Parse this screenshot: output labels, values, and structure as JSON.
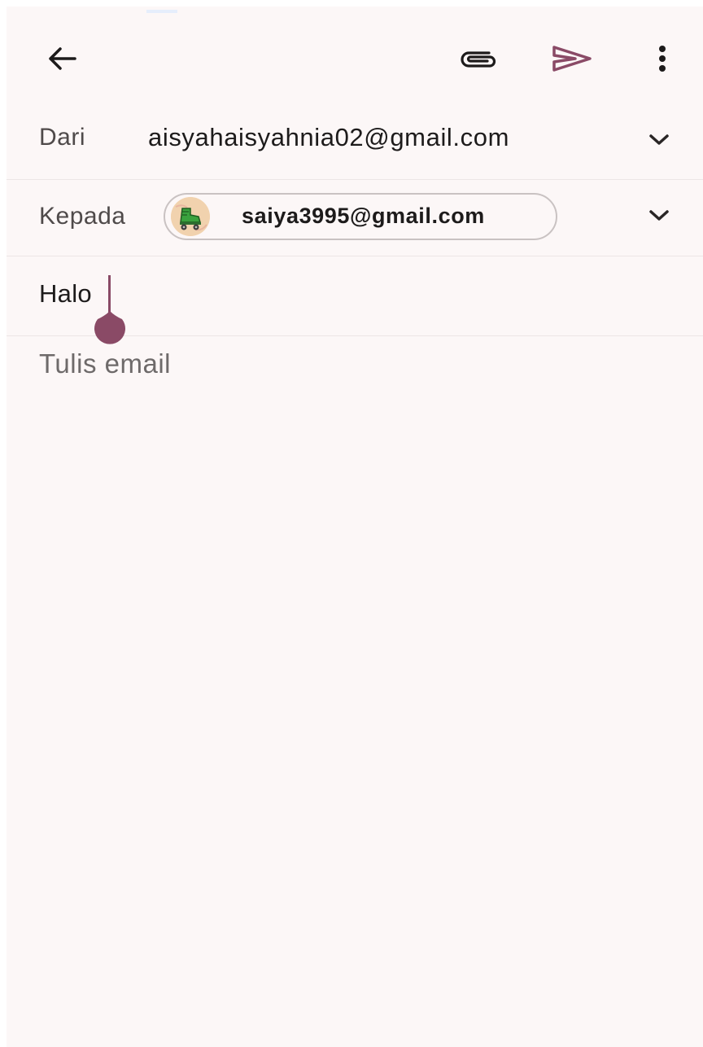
{
  "toolbar": {
    "back_icon": "arrow-left-icon",
    "attach_icon": "paperclip-icon",
    "send_icon": "send-icon",
    "more_icon": "more-vertical-icon"
  },
  "from": {
    "label": "Dari",
    "value": "aisyahaisyahnia02@gmail.com",
    "chevron_icon": "chevron-down-icon"
  },
  "to": {
    "label": "Kepada",
    "recipient": "saiya3995@gmail.com",
    "avatar_icon": "roller-skate-avatar",
    "chevron_icon": "chevron-down-icon"
  },
  "subject": {
    "value": "Halo"
  },
  "body": {
    "placeholder": "Tulis email"
  },
  "colors": {
    "background": "#fcf7f7",
    "accent": "#8a4a66",
    "text_primary": "#1d1b1b",
    "text_secondary": "#4f4a4a",
    "placeholder": "#6e6a6a"
  }
}
